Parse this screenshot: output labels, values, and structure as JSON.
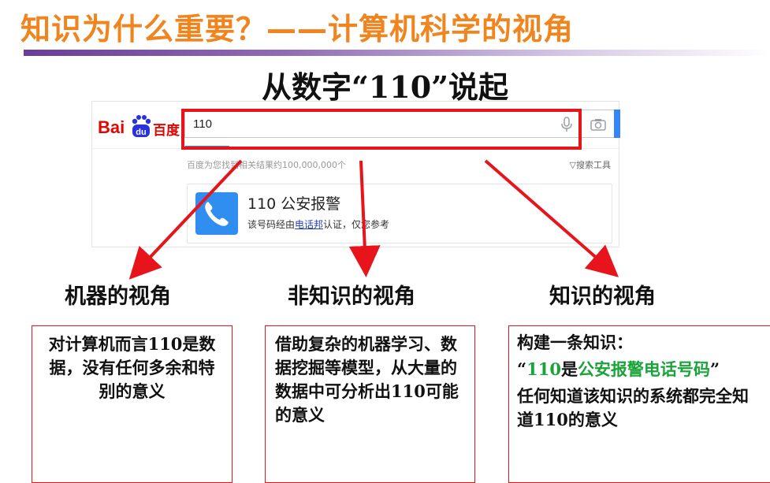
{
  "slide": {
    "title": "知识为什么重要？——计算机科学的视角",
    "subtitle": "从数字“110”说起"
  },
  "baidu": {
    "logo_latin": "Bai",
    "logo_du": "du",
    "logo_cn": "百度",
    "search_query": "110",
    "result_count": "百度为您找到相关结果约100,000,000个",
    "search_tools": "搜索工具",
    "card_title": "110  公安报警",
    "card_desc_before": "该号码经由",
    "card_desc_link": "电话邦",
    "card_desc_after": "认证，仅您参考",
    "colors": {
      "logo_red": "#e10602",
      "accent_blue": "#3385ff",
      "phone_blue": "#2f8ef0"
    }
  },
  "annotation": {
    "highlight_color": "#e8141b"
  },
  "views": [
    {
      "label": "机器的视角"
    },
    {
      "label": "非知识的视角"
    },
    {
      "label": "知识的视角"
    }
  ],
  "panels": {
    "machine": {
      "text": "对计算机而言110是数据，没有任何多余和特别的意义"
    },
    "non_knowledge": {
      "text": "借助复杂的机器学习、数据挖掘等模型，从大量的数据中可分析出110可能的意义"
    },
    "knowledge": {
      "line1": "构建一条知识：",
      "quote_open": "“",
      "num": "110",
      "is": "是",
      "green_phrase": "公安报警电话号码",
      "quote_close": "”",
      "line3": "任何知道该知识的系统都完全知道110的意义"
    }
  }
}
